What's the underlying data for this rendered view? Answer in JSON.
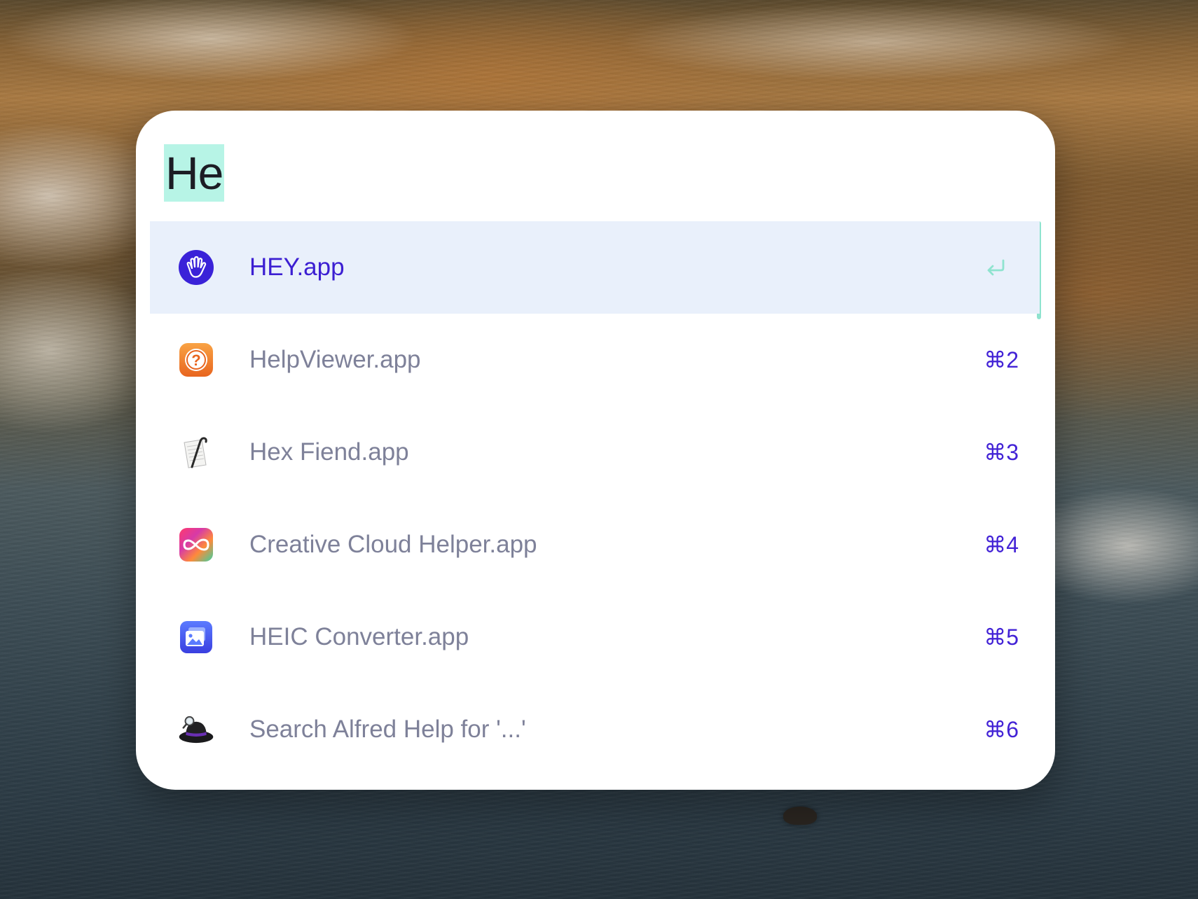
{
  "launcher": {
    "query": "He",
    "results": [
      {
        "title": "HEY.app",
        "shortcut": "",
        "selected": true,
        "icon": "hey-icon"
      },
      {
        "title": "HelpViewer.app",
        "shortcut": "⌘2",
        "selected": false,
        "icon": "help-viewer-icon"
      },
      {
        "title": "Hex Fiend.app",
        "shortcut": "⌘3",
        "selected": false,
        "icon": "hex-fiend-icon"
      },
      {
        "title": "Creative Cloud Helper.app",
        "shortcut": "⌘4",
        "selected": false,
        "icon": "creative-cloud-icon"
      },
      {
        "title": "HEIC Converter.app",
        "shortcut": "⌘5",
        "selected": false,
        "icon": "heic-converter-icon"
      },
      {
        "title": "Search Alfred Help for '...'",
        "shortcut": "⌘6",
        "selected": false,
        "icon": "alfred-hat-icon"
      }
    ]
  },
  "colors": {
    "selected_title": "#3c1fd2",
    "title": "#7e8199",
    "shortcut": "#4323d6",
    "selection_bg": "#e9f0fb",
    "query_highlight": "#b7f4e6",
    "accent": "#8fe3cf"
  }
}
